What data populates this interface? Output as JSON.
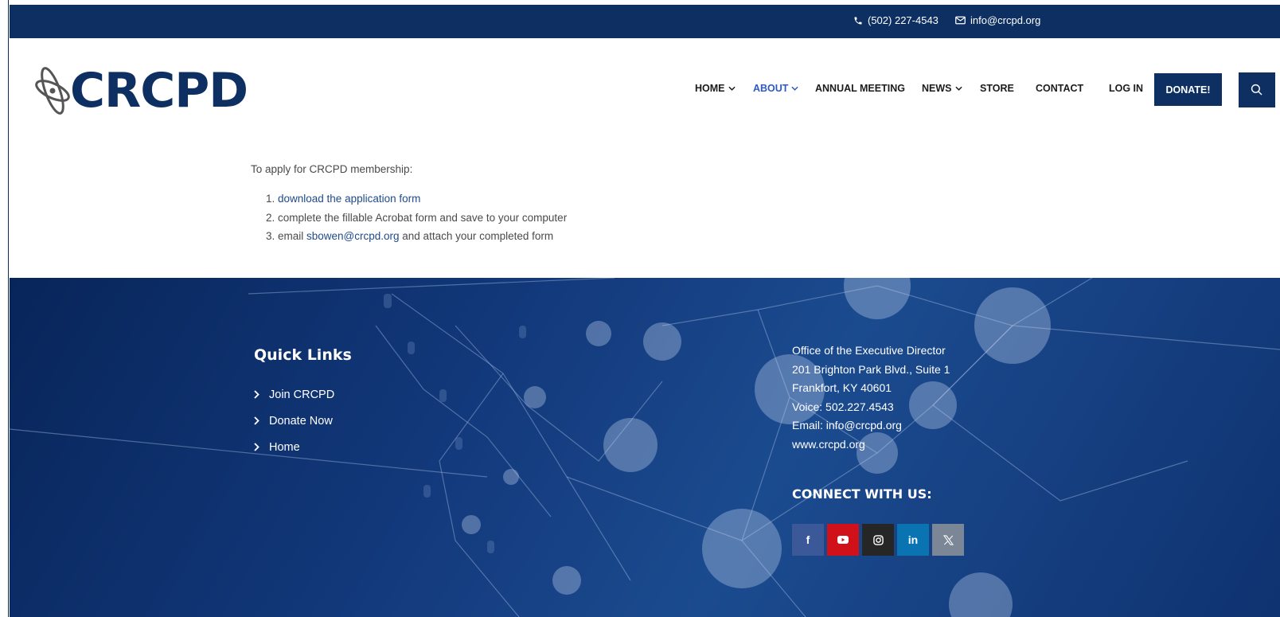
{
  "topbar": {
    "phone": "(502) 227-4543",
    "email": "info@crcpd.org",
    "phone_icon": "phone-icon",
    "email_icon": "envelope-icon"
  },
  "logo": {
    "text": "CRCPD",
    "icon": "atom-icon"
  },
  "nav": {
    "items": [
      {
        "label": "HOME",
        "has_dropdown": true,
        "active": false
      },
      {
        "label": "ABOUT",
        "has_dropdown": true,
        "active": true
      },
      {
        "label": "ANNUAL MEETING",
        "has_dropdown": false,
        "active": false
      },
      {
        "label": "NEWS",
        "has_dropdown": true,
        "active": false
      },
      {
        "label": "STORE",
        "has_dropdown": false,
        "active": false
      },
      {
        "label": "CONTACT",
        "has_dropdown": false,
        "active": false
      },
      {
        "label": "LOG IN",
        "has_dropdown": false,
        "active": false
      }
    ],
    "donate_label": "DONATE!",
    "search_icon": "search-icon"
  },
  "content": {
    "intro": "To apply for CRCPD membership:",
    "steps": [
      {
        "link": "download the application form",
        "rest": ""
      },
      {
        "prefix": "complete the fillable Acrobat form and save to your computer"
      },
      {
        "prefix": "email ",
        "link": "sbowen@crcpd.org",
        "rest": " and attach your completed form"
      }
    ]
  },
  "footer": {
    "quick_links_title": "Quick Links",
    "quick_links": [
      "Join CRCPD",
      "Donate Now",
      "Home"
    ],
    "address_lines": [
      "Office of the Executive Director",
      "201 Brighton Park Blvd., Suite 1",
      "Frankfort, KY 40601",
      "Voice: 502.227.4543",
      "Email: info@crcpd.org",
      "www.crcpd.org"
    ],
    "connect_title": "CONNECT WITH US:",
    "socials": [
      {
        "name": "facebook",
        "glyph": "f",
        "color": "#3b5998"
      },
      {
        "name": "youtube",
        "glyph": "▶",
        "color": "#d0111a"
      },
      {
        "name": "instagram",
        "glyph": "◎",
        "color": "#262626"
      },
      {
        "name": "linkedin",
        "glyph": "in",
        "color": "#0a73b1"
      },
      {
        "name": "x",
        "glyph": "𝕏",
        "color": "#7b8697"
      }
    ]
  },
  "colors": {
    "brand_navy": "#0e2f62",
    "active_nav": "#2f59c4",
    "link": "#1e4a8a"
  }
}
